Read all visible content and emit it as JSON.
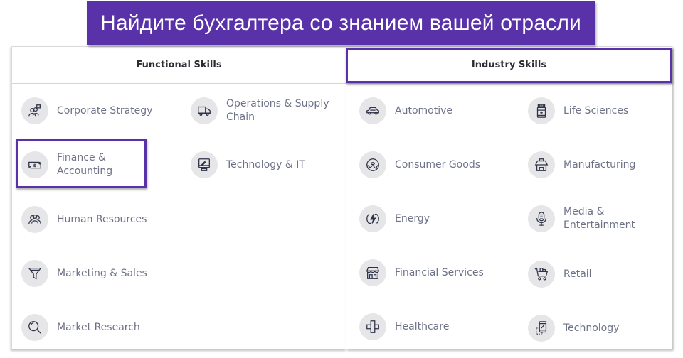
{
  "banner": {
    "title": "Найдите бухгалтера со знанием вашей отрасли"
  },
  "accent_color": "#5932a9",
  "functional": {
    "header": "Functional Skills",
    "items": [
      {
        "label": "Corporate Strategy",
        "icon": "team-strategy-icon"
      },
      {
        "label": "Operations & Supply Chain",
        "icon": "truck-icon"
      },
      {
        "label": "Finance & Accounting",
        "icon": "money-icon",
        "highlighted": true
      },
      {
        "label": "Technology & IT",
        "icon": "monitor-icon"
      },
      {
        "label": "Human Resources",
        "icon": "people-icon"
      },
      {
        "label": "Marketing & Sales",
        "icon": "funnel-icon"
      },
      {
        "label": "Market Research",
        "icon": "magnifier-icon"
      }
    ]
  },
  "industry": {
    "header": "Industry Skills",
    "highlighted": true,
    "items": [
      {
        "label": "Automotive",
        "icon": "car-icon"
      },
      {
        "label": "Life Sciences",
        "icon": "medicine-bottle-icon"
      },
      {
        "label": "Consumer Goods",
        "icon": "donut-icon"
      },
      {
        "label": "Manufacturing",
        "icon": "factory-box-icon"
      },
      {
        "label": "Energy",
        "icon": "energy-cycle-icon"
      },
      {
        "label": "Media & Entertainment",
        "icon": "microphone-icon"
      },
      {
        "label": "Financial Services",
        "icon": "bank-storefront-icon"
      },
      {
        "label": "Retail",
        "icon": "shopping-cart-icon"
      },
      {
        "label": "Healthcare",
        "icon": "medical-cross-icon"
      },
      {
        "label": "Technology",
        "icon": "mobile-device-icon"
      }
    ]
  }
}
